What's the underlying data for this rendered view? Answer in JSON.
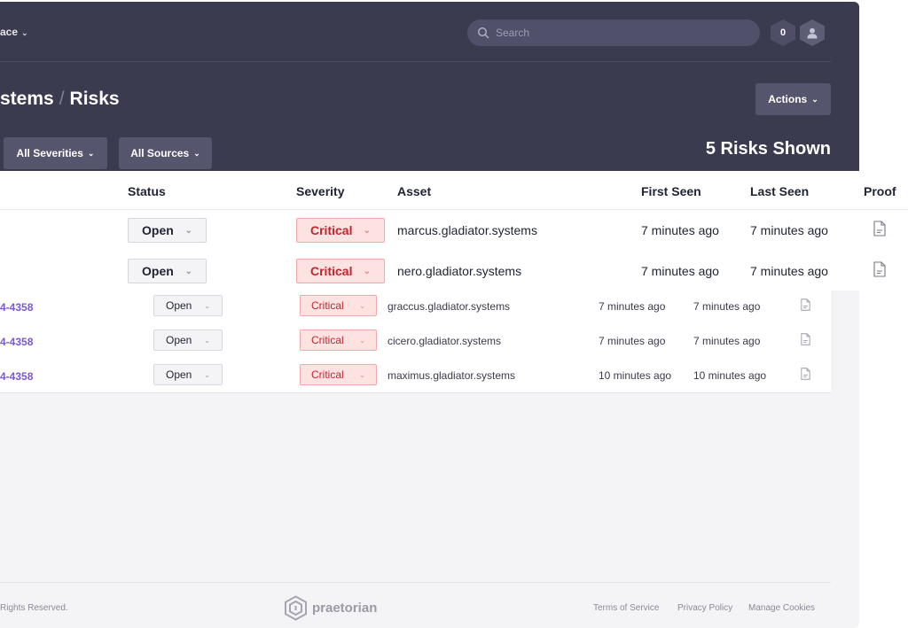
{
  "header": {
    "workspace_label": "ace",
    "search_placeholder": "Search",
    "notification_count": "0",
    "breadcrumb_parent": "stems",
    "breadcrumb_separator": "/",
    "breadcrumb_current": "Risks",
    "actions_label": "Actions",
    "severity_filter_label": "All Severities",
    "source_filter_label": "All Sources",
    "risks_shown": "5 Risks Shown"
  },
  "table": {
    "headers": {
      "status": "Status",
      "severity": "Severity",
      "asset": "Asset",
      "first_seen": "First Seen",
      "last_seen": "Last Seen",
      "proof": "Proof"
    },
    "rows": [
      {
        "id": "",
        "status": "Open",
        "severity": "Critical",
        "asset": "marcus.gladiator.systems",
        "first_seen": "7 minutes ago",
        "last_seen": "7 minutes ago"
      },
      {
        "id": "",
        "status": "Open",
        "severity": "Critical",
        "asset": "nero.gladiator.systems",
        "first_seen": "7 minutes ago",
        "last_seen": "7 minutes ago"
      },
      {
        "id": "4-4358",
        "status": "Open",
        "severity": "Critical",
        "asset": "graccus.gladiator.systems",
        "first_seen": "7 minutes ago",
        "last_seen": "7 minutes ago"
      },
      {
        "id": "4-4358",
        "status": "Open",
        "severity": "Critical",
        "asset": "cicero.gladiator.systems",
        "first_seen": "7 minutes ago",
        "last_seen": "7 minutes ago"
      },
      {
        "id": "4-4358",
        "status": "Open",
        "severity": "Critical",
        "asset": "maximus.gladiator.systems",
        "first_seen": "10 minutes ago",
        "last_seen": "10 minutes ago"
      }
    ]
  },
  "footer": {
    "copyright": "Rights Reserved.",
    "logo_text": "praetorian",
    "links": [
      "Terms of Service",
      "Privacy Policy",
      "Manage Cookies"
    ]
  },
  "icons": {
    "search": "search-icon",
    "user": "user-icon",
    "chevron": "chevron-down-icon",
    "proof": "document-icon",
    "logo": "praetorian-logo-icon"
  },
  "colors": {
    "header_bg": "#3b3b4f",
    "critical_bg": "#fde2e2",
    "critical_text": "#c0262d",
    "link_purple": "#7b57d6"
  }
}
